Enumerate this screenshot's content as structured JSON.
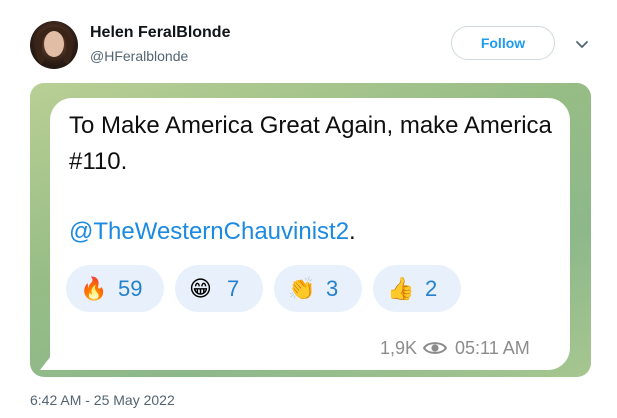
{
  "author": {
    "name": "Helen FeralBlonde",
    "handle": "@HFeralblonde"
  },
  "actions": {
    "follow_label": "Follow"
  },
  "message": {
    "text": "To Make America Great Again, make America #110.",
    "mention": "@TheWesternChauvinist2",
    "mention_suffix": "."
  },
  "reactions": [
    {
      "emoji": "🔥",
      "icon": "fire-icon",
      "count": "59"
    },
    {
      "emoji": "😁",
      "icon": "grin-icon",
      "count": "7"
    },
    {
      "emoji": "👏",
      "icon": "clap-icon",
      "count": "3"
    },
    {
      "emoji": "👍",
      "icon": "thumbs-up-icon",
      "count": "2"
    }
  ],
  "message_meta": {
    "views": "1,9K",
    "time": "05:11 AM"
  },
  "tweet_timestamp": "6:42 AM - 25 May 2022",
  "colors": {
    "link": "#1b8ae0",
    "follow": "#1d9bf0",
    "reaction_bg": "#e8f1fb"
  }
}
